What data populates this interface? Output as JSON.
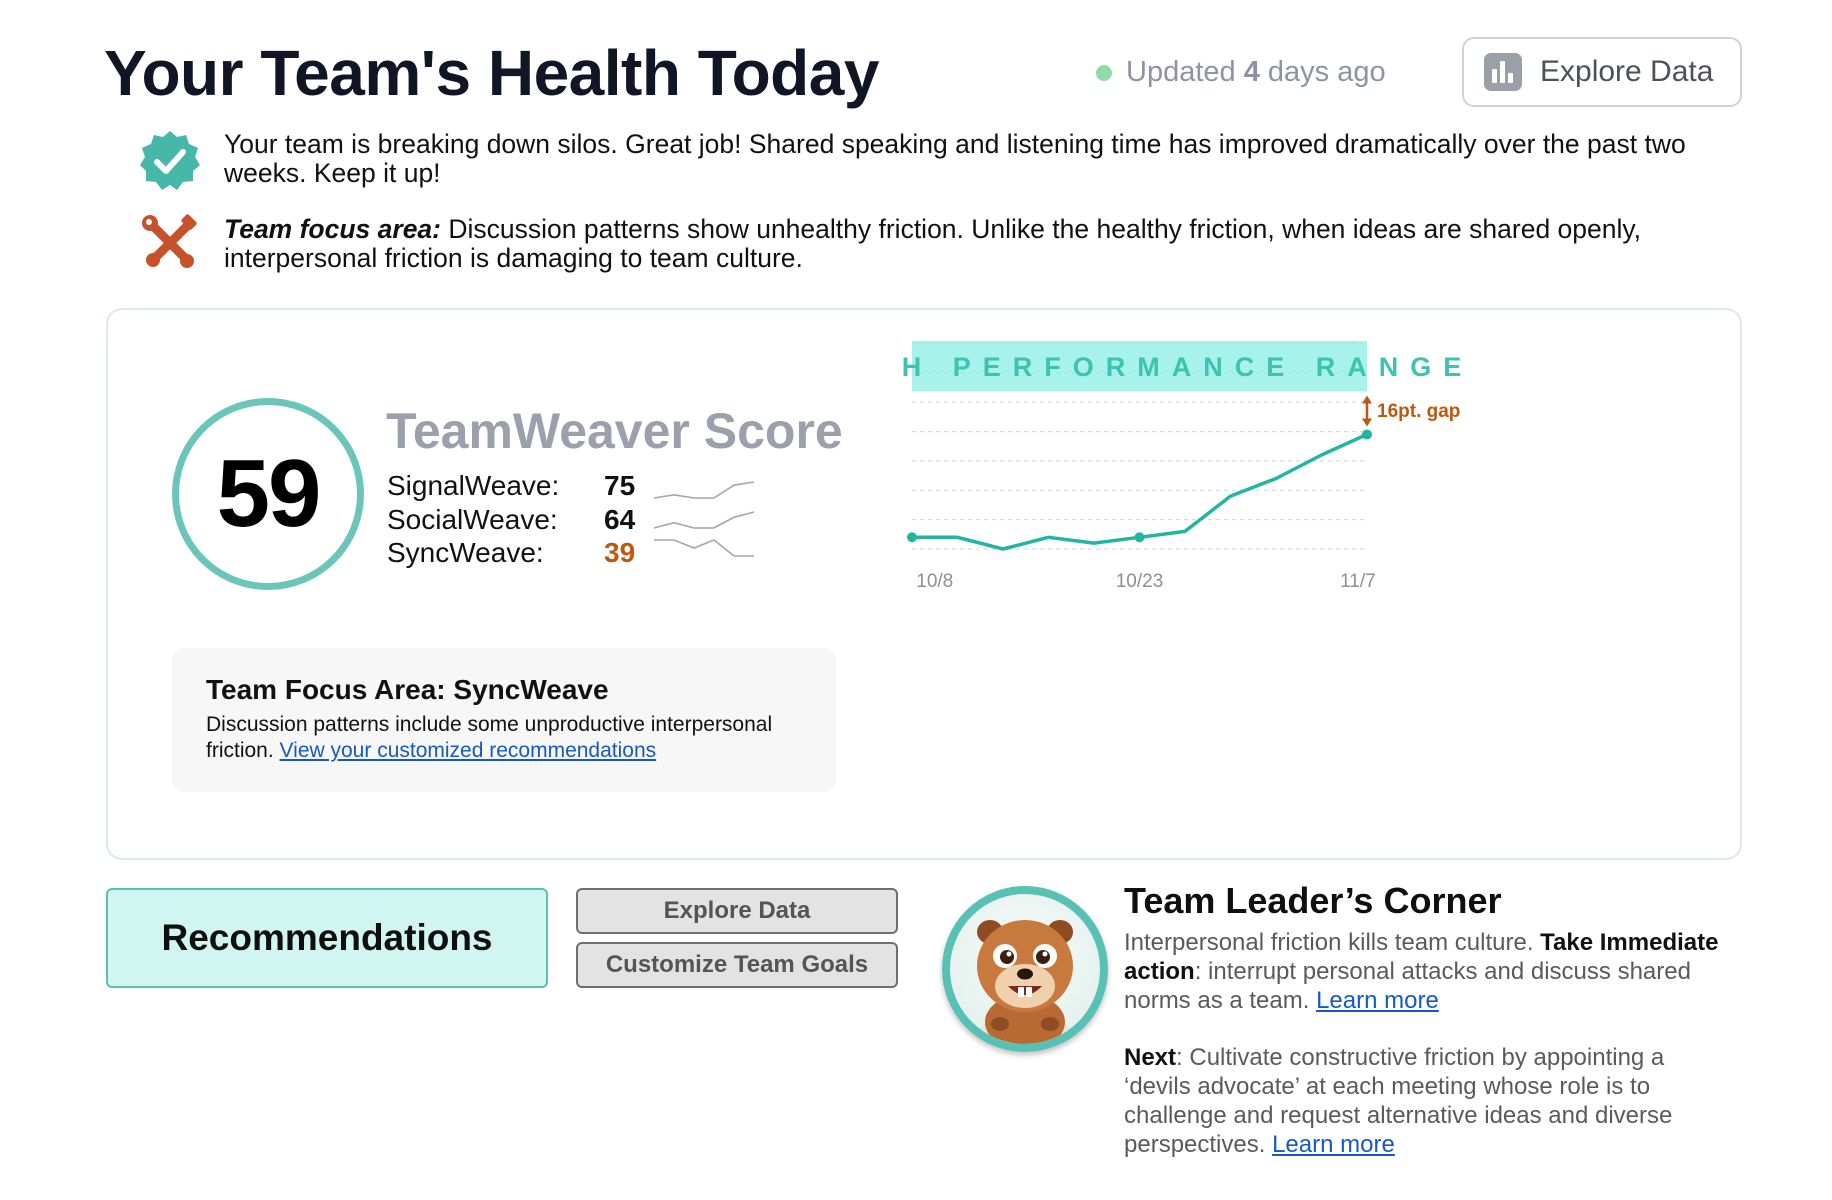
{
  "header": {
    "title": "Your Team's Health Today",
    "updated_prefix": "Updated",
    "updated_number": "4",
    "updated_suffix": "days ago",
    "explore_label": "Explore Data"
  },
  "messages": {
    "success": "Your team is breaking down silos. Great job! Shared speaking and listening time has improved dramatically over the past two weeks. Keep it up!",
    "focus_label": "Team focus area:",
    "focus_text": "Discussion patterns show unhealthy friction. Unlike the healthy friction, when ideas are shared openly, interpersonal friction is damaging to team culture."
  },
  "score": {
    "value": "59",
    "title": "TeamWeaver Score",
    "metrics": [
      {
        "label": "SignalWeave:",
        "value": "75",
        "color": "#111111",
        "trend": [
          3,
          4,
          3,
          3,
          7,
          8
        ]
      },
      {
        "label": "SocialWeave:",
        "value": "64",
        "color": "#111111",
        "trend": [
          3,
          4,
          3,
          3,
          5,
          6
        ]
      },
      {
        "label": "SyncWeave:",
        "value": "39",
        "color": "#c0570f",
        "trend": [
          5,
          5,
          4,
          5,
          3,
          3
        ]
      }
    ]
  },
  "focus_box": {
    "title": "Team Focus Area: SyncWeave",
    "text": "Discussion patterns include some unproductive interpersonal friction.",
    "link": "View your customized recommendations"
  },
  "chart_data": {
    "type": "line",
    "band_label": "HIGH PERFORMANCE RANGE",
    "band_range": [
      75,
      100
    ],
    "gap_label": "16pt. gap",
    "y_ticks": [
      "100",
      "60",
      "20"
    ],
    "ylim": [
      20,
      100
    ],
    "x_ticks": [
      "10/8",
      "10/23",
      "11/7"
    ],
    "series": [
      {
        "values": [
          24,
          24,
          20,
          24,
          22,
          24,
          26,
          38,
          44,
          52,
          59
        ],
        "color": "#22b5a2"
      }
    ],
    "highlighted_indices": [
      0,
      5,
      10
    ],
    "colors": {
      "band": "#8beee5",
      "gap": "#c0570f"
    }
  },
  "buttons": {
    "recommendations": "Recommendations",
    "explore": "Explore Data",
    "goals": "Customize Team Goals"
  },
  "leader": {
    "title": "Team Leader’s Corner",
    "p1_text": "Interpersonal friction kills team culture.",
    "p1_bold": "Take Immediate action",
    "p1_rest": ": interrupt personal attacks and discuss shared norms as a team.",
    "learn_more_1": "Learn more",
    "p2_bold": "Next",
    "p2_text": ": Cultivate constructive friction by appointing a ‘devils advocate’ at each meeting whose role is to challenge and request alternative ideas and diverse perspectives.",
    "learn_more_2": "Learn more"
  }
}
